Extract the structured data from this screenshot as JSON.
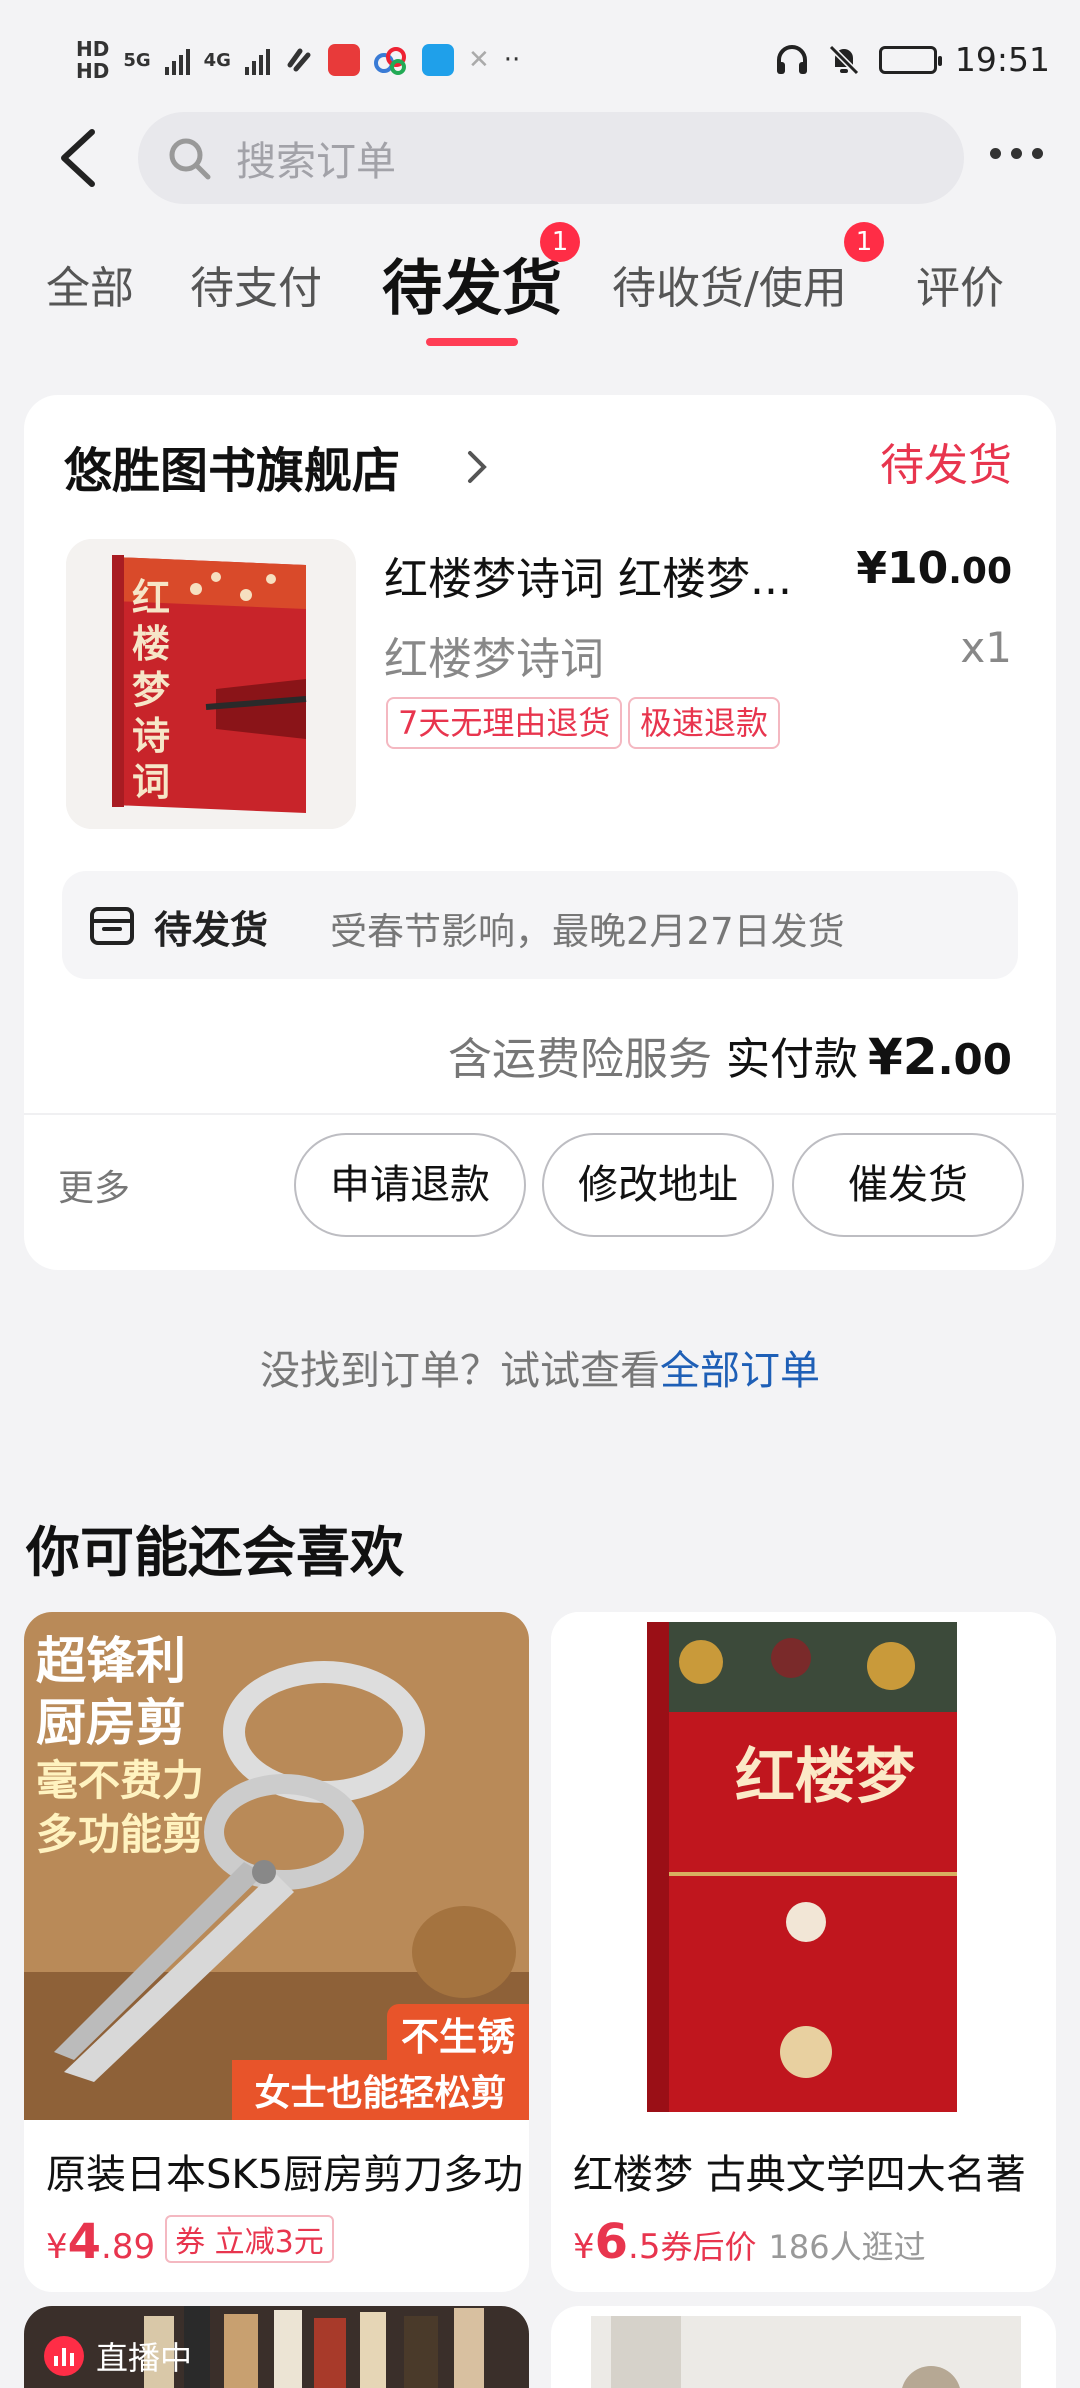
{
  "status_bar": {
    "left_labels": [
      "HD",
      "5G",
      "4G"
    ],
    "time": "19:51"
  },
  "header": {
    "search_placeholder": "搜索订单"
  },
  "tabs": [
    {
      "label": "全部"
    },
    {
      "label": "待支付"
    },
    {
      "label": "待发货",
      "badge": "1",
      "active": true
    },
    {
      "label": "待收货/使用",
      "badge": "1"
    },
    {
      "label": "评价"
    }
  ],
  "order": {
    "shop_name": "悠胜图书旗舰店",
    "status": "待发货",
    "product_title": "红楼梦诗词 红楼梦...",
    "price_int": "¥10",
    "price_dec": ".00",
    "spec": "红楼梦诗词",
    "quantity": "x1",
    "tags": [
      "7天无理由退货",
      "极速退款"
    ],
    "book_cover_text": "红楼梦诗词",
    "shipping_title": "待发货",
    "shipping_note": "受春节影响，最晚2月27日发货",
    "payment_label": "含运费险服务",
    "payment_label2": "实付款",
    "payment_int": "¥2",
    "payment_dec": ".00",
    "more_label": "更多",
    "buttons": [
      "申请退款",
      "修改地址",
      "催发货"
    ]
  },
  "no_order": {
    "text": "没找到订单？试试查看",
    "link": "全部订单"
  },
  "recommend": {
    "title": "你可能还会喜欢",
    "items": [
      {
        "name": "原装日本SK5厨房剪刀多功",
        "price_symbol": "¥",
        "price_int": "4",
        "price_dec": ".89",
        "coupon": "券 立减3元",
        "img_text": [
          "超锋利",
          "厨房剪",
          "毫不费力",
          "多功能剪",
          "不生锈",
          "女士也能轻松剪"
        ]
      },
      {
        "name": "红楼梦 古典文学四大名著",
        "price_symbol": "¥",
        "price_int": "6",
        "price_dec": ".5",
        "coupon_note": "券后价",
        "visitors": "186人逛过",
        "img_text": [
          "红楼梦"
        ]
      }
    ],
    "live_label": "直播中"
  },
  "colors": {
    "accent": "#e8354e",
    "badge": "#ff2d46",
    "link": "#1e5fb6",
    "background": "#f3f3f5"
  }
}
